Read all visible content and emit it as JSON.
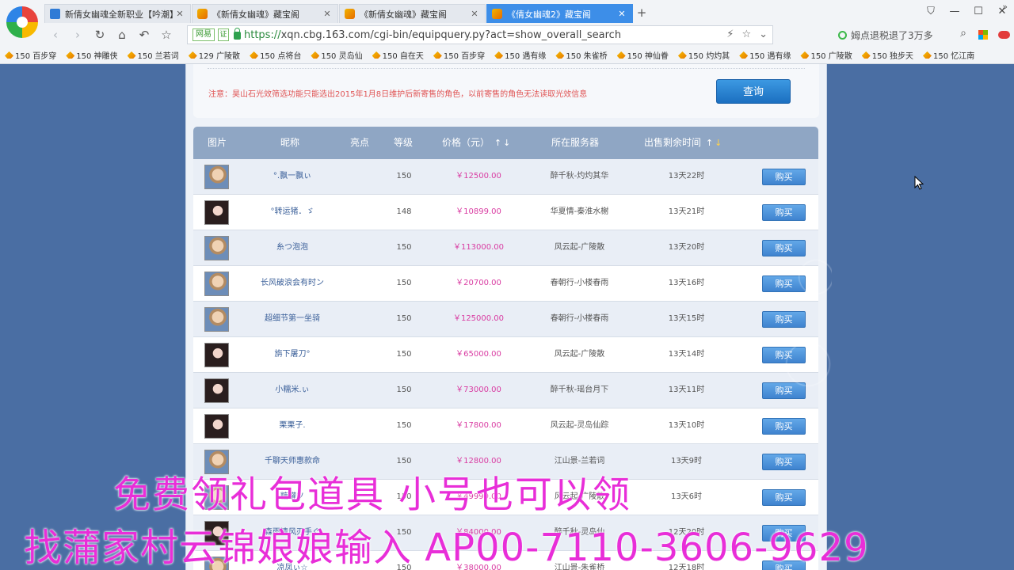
{
  "browser": {
    "tabs": [
      {
        "title": "新倩女幽魂全新职业【吟潮】上",
        "icon": "blue",
        "active": false
      },
      {
        "title": "《新倩女幽魂》藏宝阁",
        "icon": "gold",
        "active": false
      },
      {
        "title": "《新倩女幽魂》藏宝阁",
        "icon": "gold",
        "active": false
      },
      {
        "title": "《倩女幽魂2》藏宝阁",
        "icon": "gold",
        "active": true
      }
    ],
    "close_glyph": "✕",
    "new_tab_glyph": "+",
    "address": {
      "badge": "网易",
      "badge2": "证",
      "scheme": "https://",
      "url": "xqn.cbg.163.com/cgi-bin/equipquery.py?act=show_overall_search"
    },
    "search_text": "姆点退税退了3万多",
    "bookmarks": [
      "150 百步穿",
      "150 神雕侠",
      "150 兰若词",
      "129 广陵散",
      "150 点将台",
      "150 灵岛仙",
      "150 自在天",
      "150 百步穿",
      "150 遇有缘",
      "150 朱雀桥",
      "150 神仙眷",
      "150 灼灼其",
      "150 遇有缘",
      "150 广陵散",
      "150 独步天",
      "150 忆江南"
    ],
    "bookmarks_more": "»"
  },
  "search_panel": {
    "notice": "注意：昊山石光效筛选功能只能选出2015年1月8日维护后新寄售的角色，以前寄售的角色无法读取光效信息",
    "query_button": "查询"
  },
  "table": {
    "headers": {
      "image": "图片",
      "nickname": "昵称",
      "highlight": "亮点",
      "level": "等级",
      "price": "价格（元）",
      "server": "所在服务器",
      "time": "出售剩余时间"
    },
    "sort_up": "↑",
    "sort_down": "↓",
    "buy_label": "购买",
    "rows": [
      {
        "avatar": "male",
        "nickname": "°.飘一飘ぃ",
        "level": "150",
        "price": "￥12500.00",
        "server": "醉千秋-灼灼其华",
        "time": "13天22时"
      },
      {
        "avatar": "female",
        "nickname": "°转运猪．ゞ",
        "level": "148",
        "price": "￥10899.00",
        "server": "华夏情-秦淮水榭",
        "time": "13天21时"
      },
      {
        "avatar": "male",
        "nickname": "糸つ泡泡",
        "level": "150",
        "price": "￥113000.00",
        "server": "风云起-广陵散",
        "time": "13天20时"
      },
      {
        "avatar": "male",
        "nickname": "长风破浪会有时ン",
        "level": "150",
        "price": "￥20700.00",
        "server": "春朝行-小楼春雨",
        "time": "13天16时"
      },
      {
        "avatar": "male",
        "nickname": "超细节第一坐骑",
        "level": "150",
        "price": "￥125000.00",
        "server": "春朝行-小楼春雨",
        "time": "13天15时"
      },
      {
        "avatar": "female",
        "nickname": "旃下屠刀°",
        "level": "150",
        "price": "￥65000.00",
        "server": "风云起-广陵散",
        "time": "13天14时"
      },
      {
        "avatar": "female",
        "nickname": "小糯米.ぃ",
        "level": "150",
        "price": "￥73000.00",
        "server": "醉千秋-瑶台月下",
        "time": "13天11时"
      },
      {
        "avatar": "female",
        "nickname": "栗栗子.",
        "level": "150",
        "price": "￥17800.00",
        "server": "风云起-灵岛仙踪",
        "time": "13天10时"
      },
      {
        "avatar": "male",
        "nickname": "千聊天师惠款命",
        "level": "150",
        "price": "￥12800.00",
        "server": "江山景-兰若词",
        "time": "13天9时"
      },
      {
        "avatar": "male",
        "nickname": "糖罐ソ",
        "level": "150",
        "price": "￥49999.00",
        "server": "风云起-广陵散",
        "time": "13天6时"
      },
      {
        "avatar": "female",
        "nickname": "森雨清风刃手ぐ",
        "level": "150",
        "price": "￥84000.00",
        "server": "醉千秋-灵岛仙",
        "time": "12天20时"
      },
      {
        "avatar": "male",
        "nickname": "凉凤ぃ☆",
        "level": "150",
        "price": "￥38000.00",
        "server": "江山景-朱雀桥",
        "time": "12天18时"
      }
    ]
  },
  "overlay": {
    "line1": "免费领礼包道具 小号也可以领",
    "line2": "找蒲家村云锦娘娘输入 AP00-7110-3606-9629"
  },
  "colors": {
    "page_bg": "#4a6ea3",
    "table_header": "#8fa6c4",
    "price": "#d93ca2",
    "nickname": "#3a5f99",
    "notice": "#e05555",
    "overlay": "#e82ed8",
    "active_tab": "#3d8ee8"
  }
}
